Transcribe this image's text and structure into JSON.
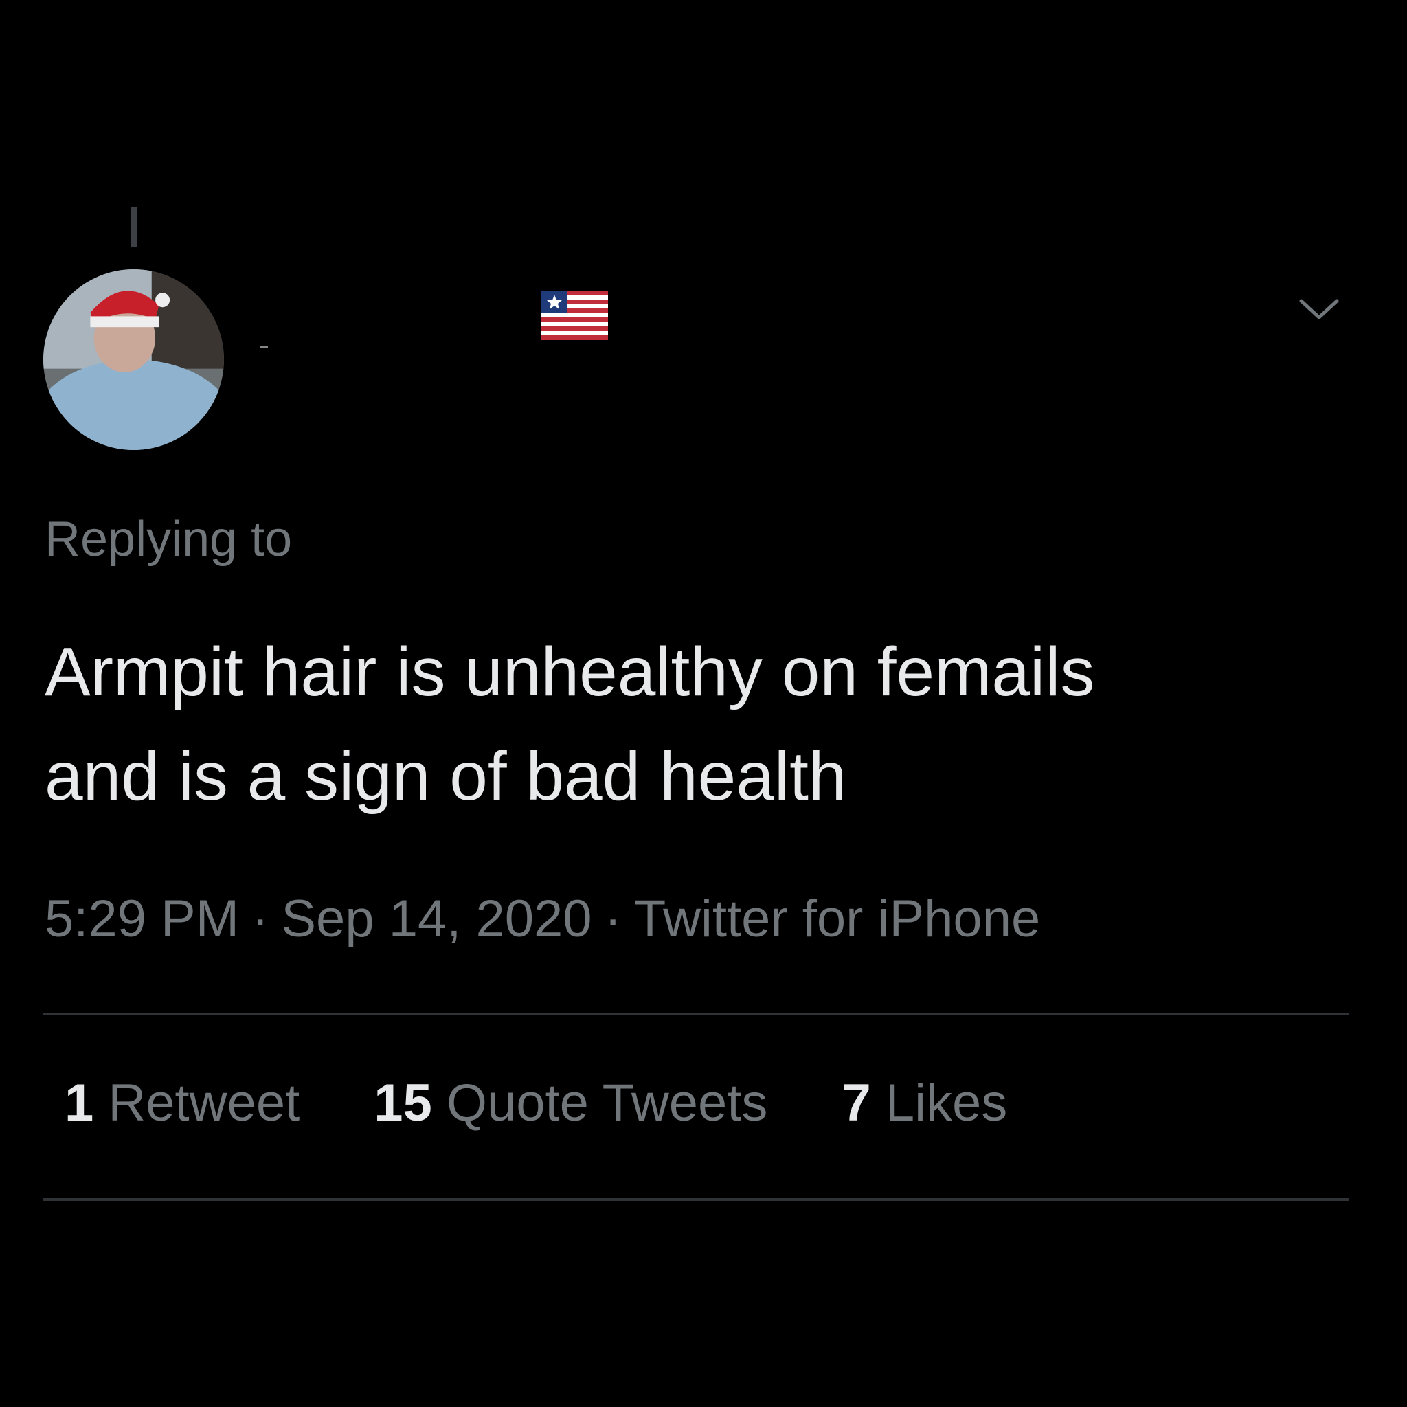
{
  "tweet": {
    "replying_to_label": "Replying to",
    "text_line_1": "Armpit hair is unhealthy on femails",
    "text_line_2": "and is a sign of bad health",
    "time": "5:29 PM",
    "separator": "·",
    "date": "Sep 14, 2020",
    "source": "Twitter for iPhone"
  },
  "stats": {
    "retweets": {
      "count": "1",
      "label": "Retweet"
    },
    "quote_tweets": {
      "count": "15",
      "label": "Quote Tweets"
    },
    "likes": {
      "count": "7",
      "label": "Likes"
    }
  },
  "icons": {
    "flag": "liberia-flag-icon",
    "more": "chevron-down-icon"
  },
  "colors": {
    "background": "#000000",
    "primary_text": "#e7e9ea",
    "secondary_text": "#71767b",
    "divider": "#2f3336"
  }
}
